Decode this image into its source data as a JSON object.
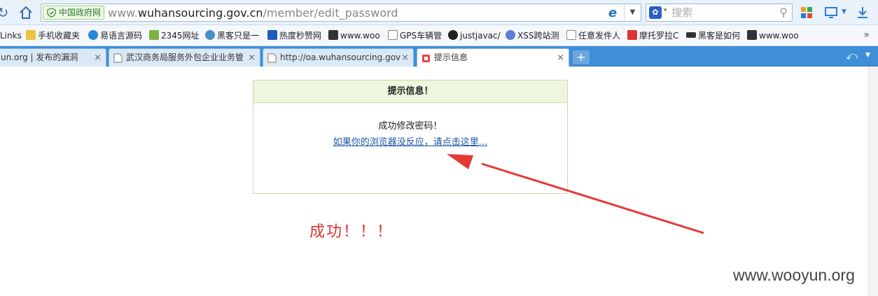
{
  "browser": {
    "address": {
      "badge": "中国政府网",
      "url_scheme": "www.",
      "url_host": "wuhansourcing.gov.cn",
      "url_path": "/member/edit_password"
    },
    "search": {
      "placeholder": "搜索"
    },
    "bookmarks": [
      "Links",
      "手机收藏夹",
      "易语言源码",
      "2345网址",
      "黑客只是一",
      "热度秒赞网",
      "www.woo",
      "GPS车辆管",
      "justjavac/",
      "XSS跨站测",
      "任意发件人",
      "摩托罗拉C",
      "黑客是如何",
      "www.woo"
    ],
    "bookmarks_more": "»",
    "tabs": [
      {
        "label": "un.org | 发布的漏洞",
        "active": false
      },
      {
        "label": "武汉商务局服务外包企业业务管",
        "active": false
      },
      {
        "label": "http://oa.wuhansourcing.gov",
        "active": false
      },
      {
        "label": "提示信息",
        "active": true
      }
    ],
    "tab_close": "×",
    "new_tab": "+"
  },
  "page": {
    "box_title": "提示信息！",
    "message": "成功修改密码！",
    "redirect_link": "如果你的浏览器没反应，请点击这里..."
  },
  "annotation": {
    "success_text": "成功！！！",
    "arrow_color": "#e53935"
  },
  "watermark": "www.wooyun.org",
  "colors": {
    "tab_bar": "#3e8fd8",
    "link": "#1a56a6",
    "success_red": "#e03131",
    "box_header": "#eef6dd"
  }
}
